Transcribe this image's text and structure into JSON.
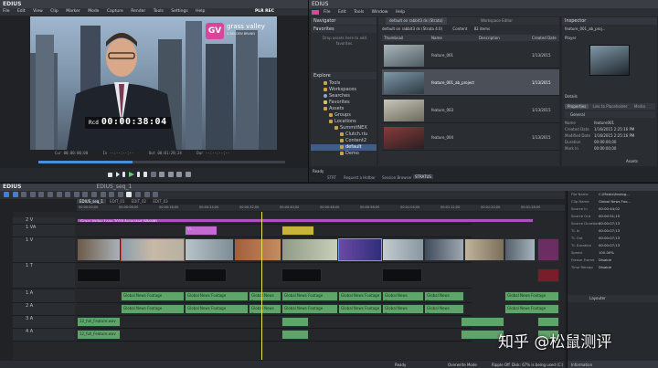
{
  "app": {
    "name": "EDIUS",
    "menu": [
      "File",
      "Edit",
      "View",
      "Clip",
      "Marker",
      "Mode",
      "Capture",
      "Render",
      "Tools",
      "Settings",
      "Help"
    ],
    "mode_label": "PLR REC",
    "bin_menu": [
      "File",
      "Edit",
      "Tools",
      "Window",
      "Help"
    ]
  },
  "player": {
    "logo_text": "grass valley",
    "logo_sub": "A BELDEN BRAND",
    "rec_label": "Rcd",
    "timecode": "00:00:38:04",
    "cur_label": "Cur 00:00:00;00",
    "in_label": "In --:--:--;--",
    "out_label": "Out 00:01:29;24",
    "dur_label": "Dur --:--:--;--"
  },
  "navigator": {
    "title": "Navigator",
    "favorites": "Favorites",
    "favorites_hint": "Drop assets here to add favorites.",
    "explore": "Explore",
    "tree": [
      {
        "label": "Tools",
        "level": 0
      },
      {
        "label": "Workspaces",
        "level": 0
      },
      {
        "label": "Searches",
        "level": 0
      },
      {
        "label": "Favorites",
        "level": 0
      },
      {
        "label": "Assets",
        "level": 0
      },
      {
        "label": "Groups",
        "level": 1
      },
      {
        "label": "Locations",
        "level": 1
      },
      {
        "label": "SummitNEX",
        "level": 2
      },
      {
        "label": "Clutch.riu",
        "level": 3
      },
      {
        "label": "Content2",
        "level": 3
      },
      {
        "label": "default",
        "level": 3
      },
      {
        "label": "Demo",
        "level": 3
      }
    ]
  },
  "browser": {
    "tab1": "default on rabbit3 ds (Strata)",
    "tab2": "Workspace Editor",
    "path": "default on rabbit3 ds (Strata 4.0)",
    "content_label": "Content",
    "item_count": "82 items",
    "columns": [
      "Thumbnail",
      "Name",
      "Description",
      "Created Date"
    ],
    "rows": [
      {
        "name": "feature_001",
        "date": "1/13/2015"
      },
      {
        "name": "feature_001_ab_project",
        "date": "1/13/2015"
      },
      {
        "name": "feature_003",
        "date": "1/13/2015"
      },
      {
        "name": "feature_004",
        "date": "1/13/2015"
      }
    ]
  },
  "inspector": {
    "title": "Inspector",
    "asset": "feature_001_ab_proj...",
    "player_label": "Player",
    "details_label": "Details",
    "properties_tab": "Properties",
    "props_link": "Link to Placeholder",
    "props_more": "Media",
    "general_label": "General",
    "fields": [
      {
        "k": "Name",
        "v": "feature001"
      },
      {
        "k": "Created Date",
        "v": "1/16/2015 2:25:16 PM"
      },
      {
        "k": "Modified Date",
        "v": "1/16/2015 2:25:16 PM"
      },
      {
        "k": "Duration",
        "v": "00:00:00;00"
      },
      {
        "k": "Mark In",
        "v": "00:00:00;00"
      }
    ],
    "assets_label": "Assets"
  },
  "status_strip": {
    "label": "Ready",
    "items": [
      "STRT",
      "Request a Hotbar",
      "Session Browser",
      "STRATUS"
    ]
  },
  "timeline": {
    "title": "EDIUS",
    "sequence": "EDIUS_seq_1",
    "tabs": [
      "EDIUS_seq_1",
      "EDIT_01",
      "EDIT_02",
      "EDIT_03"
    ],
    "ruler": [
      "00:00:00;00",
      "00:00:08;00",
      "00:00:16;00",
      "00:00:24;00",
      "00:00:32;00",
      "00:00:40;00",
      "00:00:48;00",
      "00:00:56;00",
      "00:01:04;00",
      "00:01:12;00",
      "00:01:20;00",
      "00:01:28;00"
    ],
    "tracks": [
      "2 V",
      "1 VA",
      "1 V",
      "1 T",
      "1 A",
      "2 A",
      "3 A",
      "4 A"
    ],
    "title_clip": "Grass Valley Logo 2018 Animated (WebM)",
    "graphic_clip": "Vi...",
    "audio_label": "Global News Footage",
    "audio_clip": "12_full_Feature.wav",
    "status": [
      "Ready",
      "Overwrite Mode",
      "Ripple Off",
      "Disk: 67% is being used (C:)"
    ]
  },
  "clip_info": {
    "rows": [
      {
        "k": "File Name",
        "v": "C:\\Media\\footag..."
      },
      {
        "k": "Clip Name",
        "v": "Global News Foo..."
      },
      {
        "k": "Source In",
        "v": "00:00:44;02"
      },
      {
        "k": "Source Out",
        "v": "00:00:51;15"
      },
      {
        "k": "Source Duration",
        "v": "00:00:07;13"
      },
      {
        "k": "TL In",
        "v": "00:00:07;13"
      },
      {
        "k": "TL Out",
        "v": "00:00:07;13"
      },
      {
        "k": "TL Duration",
        "v": "00:00:07;13"
      },
      {
        "k": "Speed",
        "v": "100.00%"
      },
      {
        "k": "Freeze Frame",
        "v": "Disable"
      },
      {
        "k": "Time Remap",
        "v": "Disable"
      }
    ],
    "layouter": "Layouter",
    "information": "Information"
  },
  "watermark": "知乎 @松鼠测评",
  "colors": {
    "accent": "#d8459a",
    "audio": "#5fa56a",
    "title_track": "#a855b9"
  }
}
